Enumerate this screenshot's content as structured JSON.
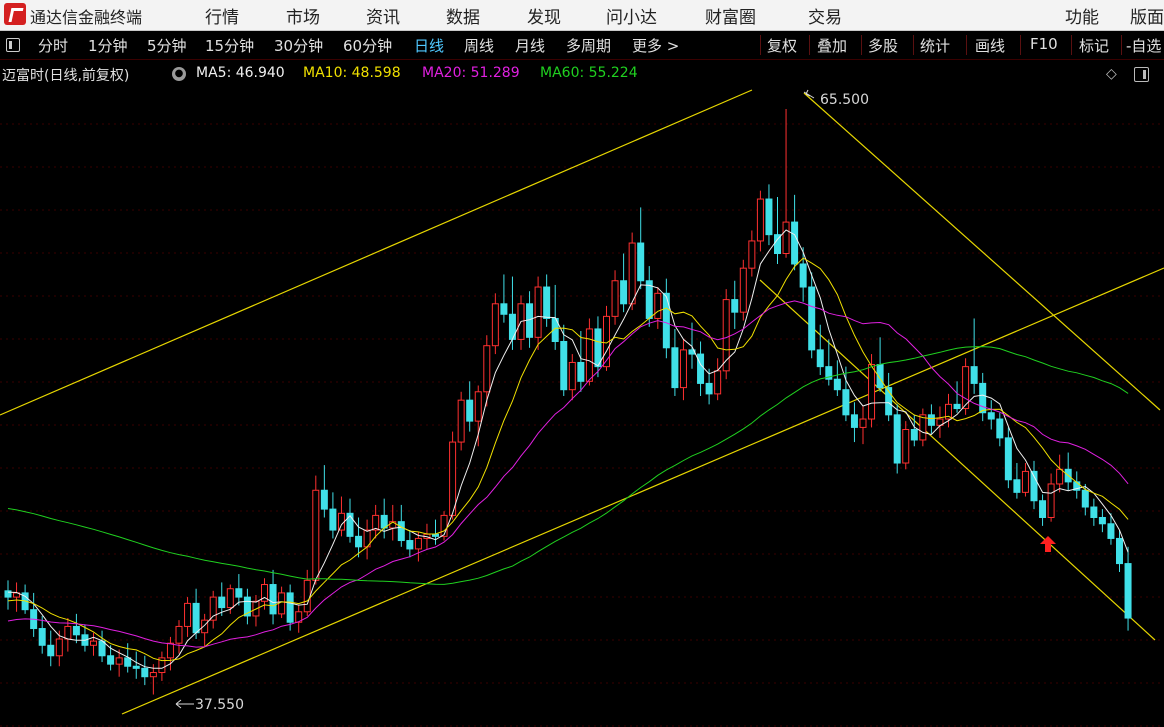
{
  "app": {
    "title": "通达信金融终端"
  },
  "menu": [
    "行情",
    "市场",
    "资讯",
    "数据",
    "发现",
    "问小达",
    "财富圈",
    "交易"
  ],
  "menu_right": [
    "功能",
    "版面"
  ],
  "toolbar": {
    "periods": [
      "分时",
      "1分钟",
      "5分钟",
      "15分钟",
      "30分钟",
      "60分钟",
      "日线",
      "周线",
      "月线",
      "多周期",
      "更多 >"
    ],
    "active": "日线",
    "tools": [
      "复权",
      "叠加",
      "多股",
      "统计",
      "画线",
      "F10",
      "标记",
      "-自选"
    ]
  },
  "info": {
    "stock": "迈富时(日线,前复权)",
    "ma": [
      {
        "label": "MA5: 46.940",
        "color": "#f0f0f0"
      },
      {
        "label": "MA10: 48.598",
        "color": "#f0e000"
      },
      {
        "label": "MA20: 51.289",
        "color": "#e020e0"
      },
      {
        "label": "MA60: 55.224",
        "color": "#20d020"
      }
    ]
  },
  "chart": {
    "high_label": "65.500",
    "low_label": "37.550",
    "colors": {
      "up": "#ff3030",
      "down": "#40e0e8",
      "trend": "#e6d600",
      "ma5": "#f0f0f0",
      "ma10": "#f0e000",
      "ma20": "#e020e0",
      "ma60": "#20d020"
    }
  },
  "chart_data": {
    "type": "candlestick",
    "ohlc": [
      [
        42.5,
        43.0,
        41.6,
        42.2
      ],
      [
        42.2,
        42.9,
        41.5,
        42.4
      ],
      [
        42.4,
        42.8,
        41.4,
        41.6
      ],
      [
        41.6,
        42.4,
        40.3,
        40.7
      ],
      [
        40.7,
        41.3,
        39.5,
        39.9
      ],
      [
        39.9,
        40.6,
        38.9,
        39.4
      ],
      [
        39.4,
        40.6,
        38.9,
        40.2
      ],
      [
        40.2,
        41.2,
        39.6,
        40.8
      ],
      [
        40.8,
        41.4,
        40.0,
        40.4
      ],
      [
        40.4,
        40.9,
        39.6,
        39.9
      ],
      [
        39.9,
        40.5,
        39.4,
        40.1
      ],
      [
        40.1,
        40.6,
        39.1,
        39.4
      ],
      [
        39.4,
        39.9,
        38.7,
        39.0
      ],
      [
        39.0,
        39.7,
        38.4,
        39.3
      ],
      [
        39.3,
        40.0,
        38.6,
        38.9
      ],
      [
        38.9,
        39.6,
        38.3,
        38.8
      ],
      [
        38.8,
        39.4,
        38.0,
        38.4
      ],
      [
        38.4,
        39.0,
        37.55,
        38.6
      ],
      [
        38.6,
        39.6,
        38.2,
        39.3
      ],
      [
        39.3,
        40.3,
        38.7,
        40.0
      ],
      [
        40.0,
        41.1,
        39.5,
        40.8
      ],
      [
        40.8,
        42.2,
        40.3,
        41.9
      ],
      [
        41.9,
        42.6,
        40.2,
        40.5
      ],
      [
        40.5,
        41.4,
        39.8,
        41.1
      ],
      [
        41.1,
        42.5,
        40.7,
        42.2
      ],
      [
        42.2,
        42.9,
        41.3,
        41.7
      ],
      [
        41.7,
        42.8,
        41.4,
        42.6
      ],
      [
        42.6,
        43.3,
        41.8,
        42.2
      ],
      [
        42.2,
        42.6,
        40.9,
        41.3
      ],
      [
        41.3,
        42.3,
        40.8,
        42.0
      ],
      [
        42.0,
        43.1,
        41.6,
        42.8
      ],
      [
        42.8,
        43.5,
        40.9,
        41.4
      ],
      [
        41.4,
        42.7,
        41.2,
        42.4
      ],
      [
        42.4,
        42.8,
        40.6,
        41.0
      ],
      [
        41.0,
        41.8,
        40.5,
        41.5
      ],
      [
        41.5,
        43.5,
        41.3,
        43.0
      ],
      [
        43.0,
        48.0,
        42.8,
        47.3
      ],
      [
        47.3,
        48.5,
        46.0,
        46.4
      ],
      [
        46.4,
        47.2,
        45.0,
        45.4
      ],
      [
        45.4,
        47.0,
        45.1,
        46.2
      ],
      [
        46.2,
        46.9,
        44.8,
        45.1
      ],
      [
        45.1,
        46.0,
        44.1,
        44.6
      ],
      [
        44.6,
        45.9,
        44.0,
        45.4
      ],
      [
        45.4,
        46.6,
        45.0,
        46.1
      ],
      [
        46.1,
        46.9,
        45.0,
        45.5
      ],
      [
        45.5,
        46.6,
        44.9,
        45.8
      ],
      [
        45.8,
        46.6,
        44.6,
        44.9
      ],
      [
        44.9,
        45.4,
        44.1,
        44.5
      ],
      [
        44.5,
        45.3,
        43.9,
        45.0
      ],
      [
        45.0,
        45.7,
        44.5,
        45.2
      ],
      [
        45.2,
        45.9,
        44.7,
        45.1
      ],
      [
        45.1,
        46.3,
        44.9,
        46.1
      ],
      [
        46.1,
        50.1,
        45.9,
        49.6
      ],
      [
        49.6,
        52.0,
        49.2,
        51.6
      ],
      [
        51.6,
        52.5,
        50.1,
        50.6
      ],
      [
        50.6,
        52.3,
        49.4,
        52.0
      ],
      [
        52.0,
        54.7,
        51.3,
        54.2
      ],
      [
        54.2,
        56.7,
        53.8,
        56.2
      ],
      [
        56.2,
        57.6,
        55.3,
        55.7
      ],
      [
        55.7,
        57.5,
        54.0,
        54.5
      ],
      [
        54.5,
        56.6,
        54.0,
        56.2
      ],
      [
        56.2,
        56.8,
        54.1,
        54.6
      ],
      [
        54.6,
        57.5,
        54.0,
        57.0
      ],
      [
        57.0,
        57.6,
        55.1,
        55.5
      ],
      [
        55.5,
        57.1,
        54.0,
        54.4
      ],
      [
        54.4,
        55.2,
        51.8,
        52.1
      ],
      [
        52.1,
        53.8,
        51.6,
        53.4
      ],
      [
        53.4,
        54.9,
        52.0,
        52.5
      ],
      [
        52.5,
        55.5,
        52.3,
        55.0
      ],
      [
        55.0,
        55.6,
        52.7,
        53.2
      ],
      [
        53.2,
        56.1,
        53.0,
        55.6
      ],
      [
        55.6,
        57.8,
        55.2,
        57.3
      ],
      [
        57.3,
        58.6,
        55.8,
        56.2
      ],
      [
        56.2,
        59.6,
        55.9,
        59.1
      ],
      [
        59.1,
        60.8,
        56.9,
        57.3
      ],
      [
        57.3,
        58.0,
        55.1,
        55.5
      ],
      [
        55.5,
        57.0,
        55.0,
        56.7
      ],
      [
        56.7,
        57.4,
        53.6,
        54.1
      ],
      [
        54.1,
        55.0,
        51.8,
        52.2
      ],
      [
        52.2,
        54.5,
        51.6,
        54.0
      ],
      [
        54.0,
        55.3,
        53.1,
        53.8
      ],
      [
        53.8,
        54.4,
        51.8,
        52.4
      ],
      [
        52.4,
        53.1,
        51.4,
        51.9
      ],
      [
        51.9,
        53.6,
        51.6,
        53.0
      ],
      [
        53.0,
        56.9,
        52.6,
        56.4
      ],
      [
        56.4,
        57.3,
        55.0,
        55.8
      ],
      [
        55.8,
        58.3,
        55.4,
        57.9
      ],
      [
        57.9,
        59.7,
        57.5,
        59.2
      ],
      [
        59.2,
        61.6,
        58.7,
        61.2
      ],
      [
        61.2,
        61.9,
        59.0,
        59.5
      ],
      [
        59.5,
        61.3,
        58.1,
        58.6
      ],
      [
        58.6,
        65.5,
        58.4,
        60.1
      ],
      [
        60.1,
        61.4,
        57.8,
        58.1
      ],
      [
        58.1,
        58.9,
        56.3,
        57.0
      ],
      [
        57.0,
        57.7,
        53.6,
        54.0
      ],
      [
        54.0,
        55.2,
        52.8,
        53.2
      ],
      [
        53.2,
        54.5,
        52.3,
        52.6
      ],
      [
        52.6,
        53.5,
        51.8,
        52.1
      ],
      [
        52.1,
        53.2,
        50.6,
        50.9
      ],
      [
        50.9,
        51.5,
        49.6,
        50.3
      ],
      [
        50.3,
        51.3,
        49.5,
        50.7
      ],
      [
        50.7,
        53.8,
        50.3,
        53.3
      ],
      [
        53.3,
        54.6,
        52.0,
        52.2
      ],
      [
        52.2,
        52.9,
        50.6,
        50.9
      ],
      [
        50.9,
        51.4,
        48.1,
        48.6
      ],
      [
        48.6,
        50.6,
        48.3,
        50.2
      ],
      [
        50.2,
        50.9,
        49.4,
        49.7
      ],
      [
        49.7,
        51.2,
        49.4,
        50.9
      ],
      [
        50.9,
        51.4,
        50.0,
        50.4
      ],
      [
        50.4,
        51.3,
        49.8,
        50.7
      ],
      [
        50.7,
        51.9,
        50.3,
        51.4
      ],
      [
        51.4,
        52.5,
        51.0,
        51.2
      ],
      [
        51.2,
        53.6,
        50.9,
        53.2
      ],
      [
        53.2,
        55.5,
        51.9,
        52.4
      ],
      [
        52.4,
        52.9,
        50.6,
        51.0
      ],
      [
        51.0,
        51.6,
        50.2,
        50.7
      ],
      [
        50.7,
        51.0,
        49.4,
        49.8
      ],
      [
        49.8,
        50.3,
        47.4,
        47.8
      ],
      [
        47.8,
        48.6,
        46.9,
        47.2
      ],
      [
        47.2,
        48.6,
        47.0,
        48.2
      ],
      [
        48.2,
        48.7,
        46.4,
        46.8
      ],
      [
        46.8,
        47.1,
        45.6,
        46.0
      ],
      [
        46.0,
        48.1,
        45.8,
        47.6
      ],
      [
        47.6,
        49.0,
        47.2,
        48.3
      ],
      [
        48.3,
        49.1,
        47.3,
        47.7
      ],
      [
        47.7,
        48.2,
        46.9,
        47.3
      ],
      [
        47.3,
        47.6,
        46.1,
        46.5
      ],
      [
        46.5,
        46.9,
        45.6,
        46.0
      ],
      [
        46.0,
        46.4,
        45.3,
        45.7
      ],
      [
        45.7,
        46.2,
        44.7,
        45.0
      ],
      [
        45.0,
        45.4,
        43.4,
        43.8
      ],
      [
        43.8,
        44.6,
        40.6,
        41.2
      ]
    ],
    "price_range": [
      36.0,
      66.5
    ],
    "high": 65.5,
    "low": 37.55,
    "ma": {
      "MA5": 46.94,
      "MA10": 48.598,
      "MA20": 51.289,
      "MA60": 55.224
    }
  }
}
